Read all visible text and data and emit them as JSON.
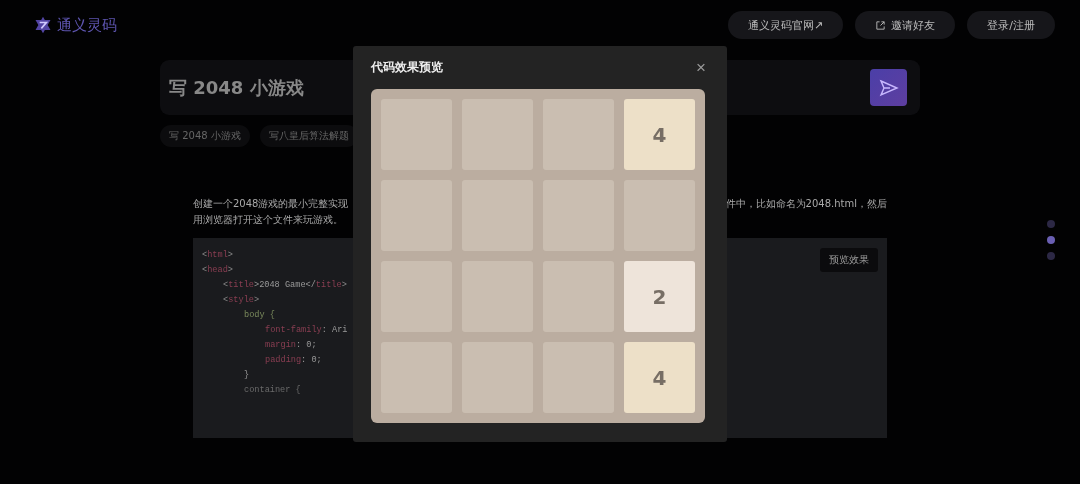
{
  "header": {
    "logo_text": "通义灵码",
    "buttons": [
      {
        "label": "通义灵码官网↗",
        "kind": "plain"
      },
      {
        "label": "邀请好友",
        "kind": "share"
      },
      {
        "label": "登录/注册",
        "kind": "plain"
      }
    ]
  },
  "prompt": {
    "value": "写 2048 小游戏"
  },
  "suggestions": [
    "写 2048 小游戏",
    "写八皇后算法解题"
  ],
  "answer": {
    "line_1_start": "创建一个2048游戏的最小完整实现",
    "line_1_end": "件中，比如命名为2048.html，然后",
    "line_2": "用浏览器打开这个文件来玩游戏。"
  },
  "code": {
    "preview_button": "预览效果",
    "lines": [
      {
        "parts": [
          {
            "kind": "punct",
            "text": "<"
          },
          {
            "kind": "keyword",
            "text": "html"
          },
          {
            "kind": "punct",
            "text": ">"
          }
        ]
      },
      {
        "parts": [
          {
            "kind": "punct",
            "text": "<"
          },
          {
            "kind": "keyword",
            "text": "head"
          },
          {
            "kind": "punct",
            "text": ">"
          }
        ],
        "children": [
          {
            "parts": [
              {
                "kind": "punct",
                "text": "<"
              },
              {
                "kind": "keyword",
                "text": "title"
              },
              {
                "kind": "plain",
                "text": ">2048 Game</"
              },
              {
                "kind": "keyword",
                "text": "title"
              },
              {
                "kind": "punct",
                "text": ">"
              }
            ]
          },
          {
            "parts": [
              {
                "kind": "punct",
                "text": "<"
              },
              {
                "kind": "keyword",
                "text": "style"
              },
              {
                "kind": "punct",
                "text": ">"
              }
            ],
            "children": [
              {
                "parts": [
                  {
                    "kind": "selector",
                    "text": "body {"
                  }
                ],
                "children": [
                  {
                    "parts": [
                      {
                        "kind": "keyword",
                        "text": "font-family"
                      },
                      {
                        "kind": "plain",
                        "text": ": Ari"
                      }
                    ]
                  },
                  {
                    "parts": [
                      {
                        "kind": "keyword",
                        "text": "margin"
                      },
                      {
                        "kind": "plain",
                        "text": ": 0;"
                      }
                    ]
                  },
                  {
                    "parts": [
                      {
                        "kind": "keyword",
                        "text": "padding"
                      },
                      {
                        "kind": "plain",
                        "text": ": 0;"
                      }
                    ]
                  }
                ]
              },
              {
                "parts": [
                  {
                    "kind": "plain",
                    "text": "}"
                  }
                ]
              },
              {
                "parts": [
                  {
                    "kind": "faded",
                    "text": "container {"
                  }
                ]
              }
            ]
          }
        ]
      }
    ]
  },
  "dots": [
    {
      "selected": false
    },
    {
      "selected": true
    },
    {
      "selected": false
    }
  ],
  "modal": {
    "title": "代码效果预览",
    "close": "×",
    "board": [
      [
        {
          "kind": "empty"
        },
        {
          "kind": "empty"
        },
        {
          "kind": "empty"
        },
        {
          "kind": "number",
          "value": "4"
        }
      ],
      [
        {
          "kind": "empty"
        },
        {
          "kind": "empty"
        },
        {
          "kind": "empty"
        },
        {
          "kind": "empty"
        }
      ],
      [
        {
          "kind": "empty"
        },
        {
          "kind": "empty"
        },
        {
          "kind": "empty"
        },
        {
          "kind": "number",
          "value": "2"
        }
      ],
      [
        {
          "kind": "empty"
        },
        {
          "kind": "empty"
        },
        {
          "kind": "empty"
        },
        {
          "kind": "number",
          "value": "4"
        }
      ]
    ]
  }
}
